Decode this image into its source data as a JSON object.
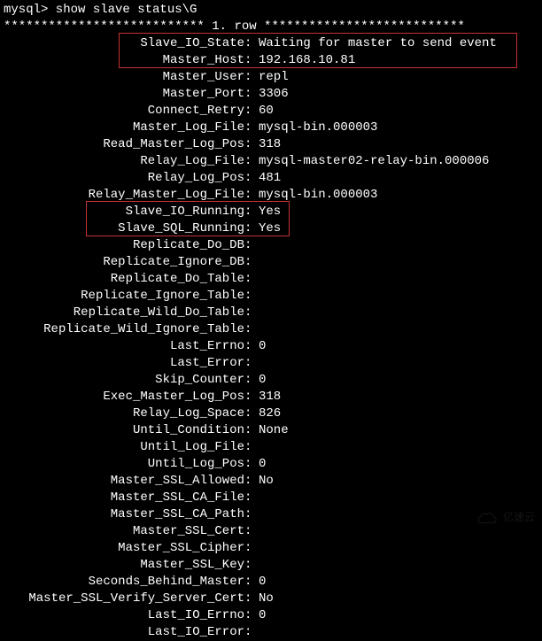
{
  "prompt": "mysql> show slave status\\G",
  "row_header": "*************************** 1. row ***************************",
  "fields": [
    {
      "label": "Slave_IO_State",
      "value": "Waiting for master to send event"
    },
    {
      "label": "Master_Host",
      "value": "192.168.10.81"
    },
    {
      "label": "Master_User",
      "value": "repl"
    },
    {
      "label": "Master_Port",
      "value": "3306"
    },
    {
      "label": "Connect_Retry",
      "value": "60"
    },
    {
      "label": "Master_Log_File",
      "value": "mysql-bin.000003"
    },
    {
      "label": "Read_Master_Log_Pos",
      "value": "318"
    },
    {
      "label": "Relay_Log_File",
      "value": "mysql-master02-relay-bin.000006"
    },
    {
      "label": "Relay_Log_Pos",
      "value": "481"
    },
    {
      "label": "Relay_Master_Log_File",
      "value": "mysql-bin.000003"
    },
    {
      "label": "Slave_IO_Running",
      "value": "Yes"
    },
    {
      "label": "Slave_SQL_Running",
      "value": "Yes"
    },
    {
      "label": "Replicate_Do_DB",
      "value": ""
    },
    {
      "label": "Replicate_Ignore_DB",
      "value": ""
    },
    {
      "label": "Replicate_Do_Table",
      "value": ""
    },
    {
      "label": "Replicate_Ignore_Table",
      "value": ""
    },
    {
      "label": "Replicate_Wild_Do_Table",
      "value": ""
    },
    {
      "label": "Replicate_Wild_Ignore_Table",
      "value": ""
    },
    {
      "label": "Last_Errno",
      "value": "0"
    },
    {
      "label": "Last_Error",
      "value": ""
    },
    {
      "label": "Skip_Counter",
      "value": "0"
    },
    {
      "label": "Exec_Master_Log_Pos",
      "value": "318"
    },
    {
      "label": "Relay_Log_Space",
      "value": "826"
    },
    {
      "label": "Until_Condition",
      "value": "None"
    },
    {
      "label": "Until_Log_File",
      "value": ""
    },
    {
      "label": "Until_Log_Pos",
      "value": "0"
    },
    {
      "label": "Master_SSL_Allowed",
      "value": "No"
    },
    {
      "label": "Master_SSL_CA_File",
      "value": ""
    },
    {
      "label": "Master_SSL_CA_Path",
      "value": ""
    },
    {
      "label": "Master_SSL_Cert",
      "value": ""
    },
    {
      "label": "Master_SSL_Cipher",
      "value": ""
    },
    {
      "label": "Master_SSL_Key",
      "value": ""
    },
    {
      "label": "Seconds_Behind_Master",
      "value": "0"
    },
    {
      "label": "Master_SSL_Verify_Server_Cert",
      "value": "No"
    },
    {
      "label": "Last_IO_Errno",
      "value": "0"
    },
    {
      "label": "Last_IO_Error",
      "value": ""
    }
  ],
  "watermark_text": "亿速云"
}
